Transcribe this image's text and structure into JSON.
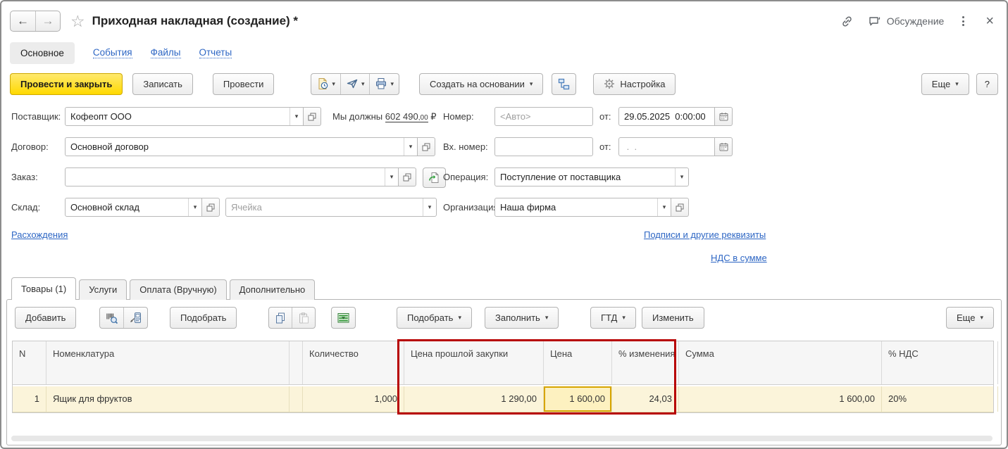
{
  "window": {
    "title": "Приходная накладная (создание) *",
    "discussion": "Обсуждение"
  },
  "nav_tabs": {
    "main": "Основное",
    "events": "События",
    "files": "Файлы",
    "reports": "Отчеты"
  },
  "toolbar": {
    "post_close": "Провести и закрыть",
    "write": "Записать",
    "post": "Провести",
    "create_from": "Создать на основании",
    "settings": "Настройка",
    "more": "Еще",
    "help": "?"
  },
  "fields": {
    "supplier_label": "Поставщик:",
    "supplier_value": "Кофеопт ООО",
    "debt_prefix": "Мы должны",
    "debt_amount": "602 490",
    "debt_cents": ",00",
    "debt_currency": "₽",
    "number_label": "Номер:",
    "number_placeholder": "<Авто>",
    "date_label": "от:",
    "date_value": "29.05.2025  0:00:00",
    "contract_label": "Договор:",
    "contract_value": "Основной договор",
    "in_number_label": "Вх. номер:",
    "in_number_value": "",
    "in_date_label": "от:",
    "in_date_value": " .  .",
    "order_label": "Заказ:",
    "order_value": "",
    "operation_label": "Операция:",
    "operation_value": "Поступление от поставщика",
    "warehouse_label": "Склад:",
    "warehouse_value": "Основной склад",
    "cell_placeholder": "Ячейка",
    "org_label": "Организация:",
    "org_value": "Наша фирма"
  },
  "links": {
    "discrepancies": "Расхождения",
    "signatures": "Подписи и другие реквизиты",
    "vat_mode": "НДС в сумме"
  },
  "detail_tabs": {
    "goods": "Товары (1)",
    "services": "Услуги",
    "payment": "Оплата (Вручную)",
    "additional": "Дополнительно"
  },
  "table_toolbar": {
    "add": "Добавить",
    "pick": "Подобрать",
    "pick_menu": "Подобрать",
    "fill_menu": "Заполнить",
    "gtd": "ГТД",
    "edit": "Изменить",
    "more": "Еще"
  },
  "table": {
    "headers": {
      "n": "N",
      "item": "Номенклатура",
      "qty": "Количество",
      "prev_price": "Цена прошлой закупки",
      "price": "Цена",
      "change_pct": "% изменения",
      "sum": "Сумма",
      "vat": "% НДС"
    },
    "rows": [
      {
        "n": "1",
        "item": "Ящик для фруктов",
        "qty": "1,000",
        "prev_price": "1 290,00",
        "price": "1 600,00",
        "change_pct": "24,03",
        "sum": "1 600,00",
        "vat": "20%"
      }
    ]
  },
  "icons": {
    "back": "←",
    "forward": "→",
    "star": "☆",
    "close": "×",
    "caret": "▾",
    "help": "?"
  },
  "colors": {
    "accent_yellow": "#ffd900",
    "link_blue": "#2d66c4",
    "highlight_red": "#b70000",
    "row_yellow": "#fbf4da",
    "selected_cell_border": "#d7a500"
  }
}
